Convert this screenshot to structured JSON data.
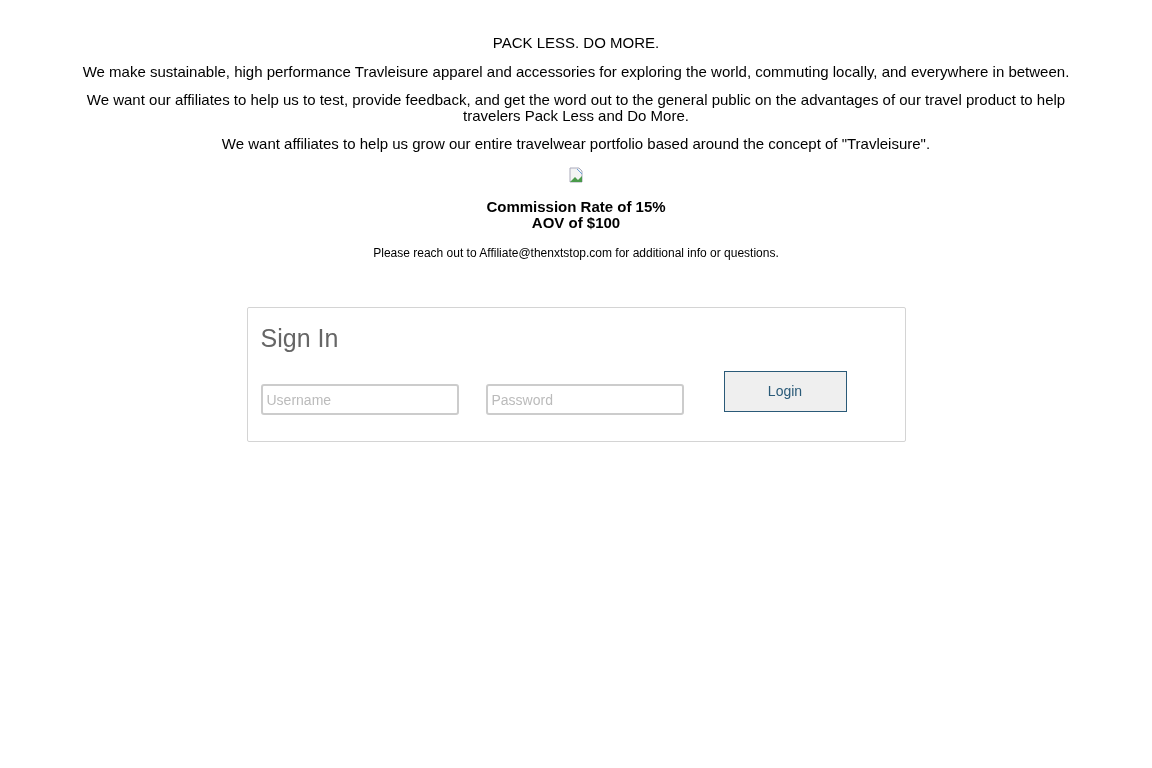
{
  "intro": {
    "tagline": "PACK LESS. DO MORE.",
    "paragraphs": [
      "We make sustainable, high performance Travleisure apparel and accessories for exploring the world, commuting locally, and everywhere in between.",
      "We want our affiliates to help us to test, provide feedback, and get the word out to the general public on the advantages of our travel product to help travelers Pack Less and Do More.",
      "We want affiliates to help us grow our entire travelwear portfolio based around the concept of \"Travleisure\"."
    ],
    "terms": [
      "Commission Rate of 15%",
      "AOV of $100"
    ],
    "contact": "Please reach out to Affiliate@thenxtstop.com for additional info or questions."
  },
  "sign_in": {
    "title": "Sign In",
    "username": {
      "placeholder": "Username"
    },
    "password": {
      "placeholder": "Password"
    },
    "button": "Login"
  }
}
